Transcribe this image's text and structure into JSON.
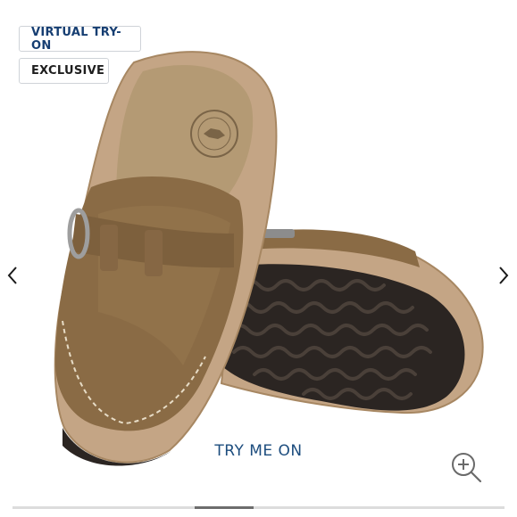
{
  "badges": {
    "virtual_try_on": "VIRTUAL TRY-ON",
    "exclusive": "EXCLUSIVE"
  },
  "carousel": {
    "prev_icon": "chevron-left-icon",
    "next_icon": "chevron-right-icon",
    "progress_fraction": 0.12,
    "progress_start_fraction": 0.37
  },
  "try_on": {
    "label": "TRY ME ON"
  },
  "zoom": {
    "icon": "zoom-in-icon"
  },
  "colors": {
    "suede": "#8a6b45",
    "footbed": "#b49a74",
    "cork": "#c4a585",
    "sole": "#2b2522",
    "accent": "#1d4d7e"
  }
}
